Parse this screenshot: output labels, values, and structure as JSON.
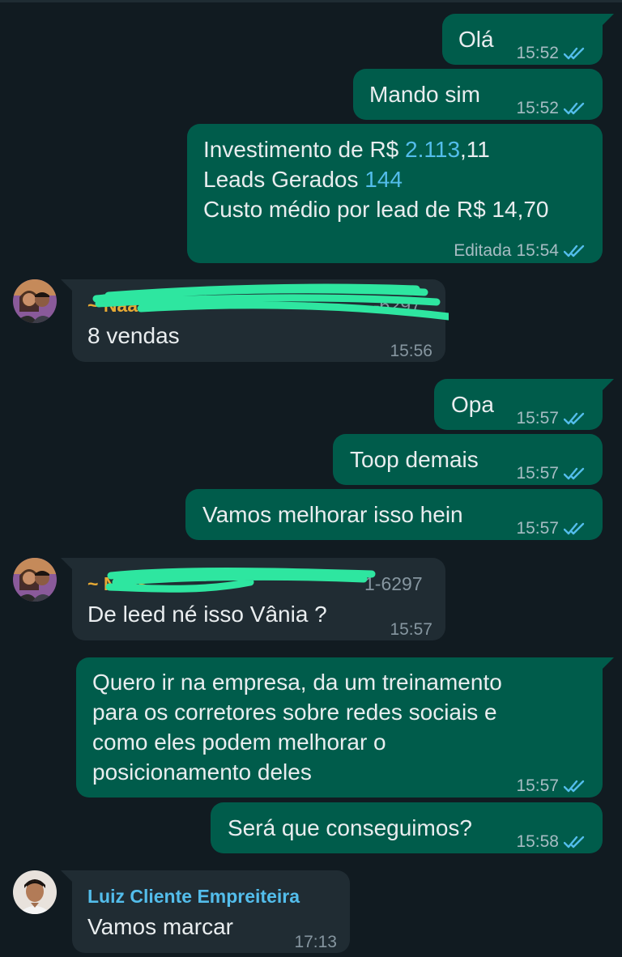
{
  "colors": {
    "background": "#111b21",
    "outgoing_bubble": "#005c4b",
    "incoming_bubble": "#202c33",
    "read_ticks": "#53bdeb",
    "sender_orange": "#e6a934",
    "sender_blue": "#53bdeb",
    "scribble": "#2ee6a0"
  },
  "messages": [
    {
      "direction": "out",
      "text": "Olá",
      "time": "15:52",
      "status": "read"
    },
    {
      "direction": "out",
      "text": "Mando sim",
      "time": "15:52",
      "status": "read"
    },
    {
      "direction": "out",
      "lines": [
        {
          "before": "Investimento de R$ ",
          "value": "2.113",
          "after": ",11"
        },
        {
          "before": "Leads Gerados ",
          "value": "144"
        },
        {
          "before": "Custo médio por lead de R$ 14,70"
        }
      ],
      "edited_label": "Editada",
      "time": "15:54",
      "status": "read"
    },
    {
      "direction": "in",
      "sender": "~ Naas",
      "sender_partial": "-6297",
      "text": "8 vendas",
      "time": "15:56"
    },
    {
      "direction": "out",
      "text": "Opa",
      "time": "15:57",
      "status": "read"
    },
    {
      "direction": "out",
      "text": "Toop demais",
      "time": "15:57",
      "status": "read"
    },
    {
      "direction": "out",
      "text": "Vamos melhorar isso hein",
      "time": "15:57",
      "status": "read"
    },
    {
      "direction": "in",
      "sender": "~ Naas",
      "sender_partial": "1-6297",
      "text": "De leed né isso Vânia ?",
      "time": "15:57"
    },
    {
      "direction": "out",
      "lines": [
        "Quero ir na empresa, da um treinamento",
        "para os corretores sobre redes sociais e",
        "como eles podem melhorar o",
        "posicionamento deles"
      ],
      "time": "15:57",
      "status": "read"
    },
    {
      "direction": "out",
      "text": "Será que conseguimos?",
      "time": "15:58",
      "status": "read"
    },
    {
      "direction": "in",
      "sender": "Luiz Cliente Empreiteira",
      "text": "Vamos marcar",
      "time": "17:13"
    }
  ]
}
